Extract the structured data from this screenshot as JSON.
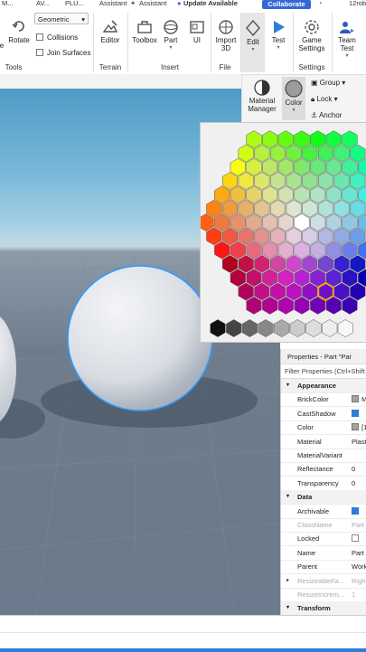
{
  "topbar": {
    "items": [
      "M...",
      "AV...",
      "PLU...",
      "Assistant",
      "Update Available"
    ],
    "collaborate": "Collaborate",
    "user": "12rob"
  },
  "ribbon": {
    "rotate": "Rotate",
    "tools_group": "Tools",
    "select_mode": "Geometric",
    "collisions": "Collisions",
    "join_surfaces": "Join Surfaces",
    "editor": "Editor",
    "terrain_group": "Terrain",
    "toolbox": "Toolbox",
    "part": "Part",
    "ui": "UI",
    "insert_group": "Insert",
    "import3d_line1": "Import",
    "import3d_line2": "3D",
    "file_group": "File",
    "edit": "Edit",
    "test": "Test",
    "game_settings_line1": "Game",
    "game_settings_line2": "Settings",
    "settings_group": "Settings",
    "team_test_line1": "Team",
    "team_test_line2": "Test"
  },
  "material_panel": {
    "material_manager_line1": "Material",
    "material_manager_line2": "Manager",
    "color": "Color",
    "group": "Group",
    "lock": "Lock",
    "anchor": "Anchor"
  },
  "properties": {
    "title": "Properties - Part \"Par",
    "filter_placeholder": "Filter Properties (Ctrl+Shift",
    "rows": [
      {
        "type": "section",
        "name": "Appearance"
      },
      {
        "type": "prop",
        "name": "BrickColor",
        "value": "M",
        "swatch": "#a3a2a5"
      },
      {
        "type": "prop",
        "name": "CastShadow",
        "check": true
      },
      {
        "type": "prop",
        "name": "Color",
        "value": "[1",
        "swatch": "#a3a2a5"
      },
      {
        "type": "prop",
        "name": "Material",
        "value": "Plasti"
      },
      {
        "type": "prop",
        "name": "MaterialVariant",
        "value": ""
      },
      {
        "type": "prop",
        "name": "Reflectance",
        "value": "0"
      },
      {
        "type": "prop",
        "name": "Transparency",
        "value": "0"
      },
      {
        "type": "section",
        "name": "Data"
      },
      {
        "type": "prop",
        "name": "Archivable",
        "check": true
      },
      {
        "type": "prop",
        "name": "ClassName",
        "value": "Part",
        "muted": true
      },
      {
        "type": "prop",
        "name": "Locked",
        "check": false
      },
      {
        "type": "prop",
        "name": "Name",
        "value": "Part"
      },
      {
        "type": "prop",
        "name": "Parent",
        "value": "Work"
      },
      {
        "type": "prop",
        "name": "ResizeableFa...",
        "value": "Right",
        "muted": true,
        "expand": true
      },
      {
        "type": "prop",
        "name": "ResizeIncrem...",
        "value": "1",
        "muted": true
      },
      {
        "type": "section",
        "name": "Transform"
      }
    ]
  },
  "colors": {
    "accent": "#3567d6",
    "selection_outline": "#2f9bff",
    "selected_hex": "#f5a623"
  }
}
